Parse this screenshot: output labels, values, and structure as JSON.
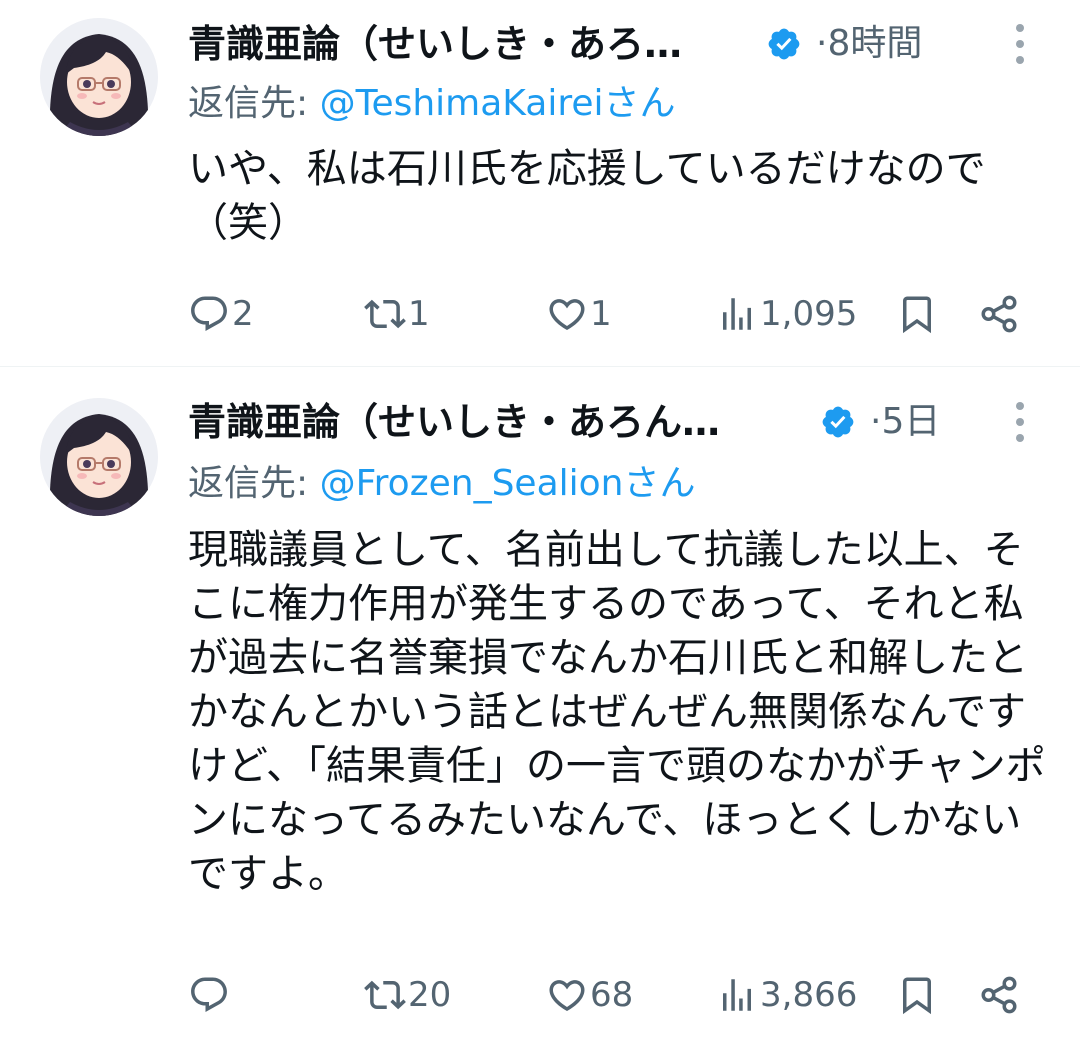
{
  "tweets": [
    {
      "display_name": "青識亜論（せいしき・あろ…",
      "time": "·8時間",
      "reply_prefix": "返信先: ",
      "reply_handle": "@TeshimaKaireiさん",
      "text": "いや、私は石川氏を応援しているだけなので（笑）",
      "replies": "2",
      "retweets": "1",
      "likes": "1",
      "views": "1,095"
    },
    {
      "display_name": "青識亜論（せいしき・あろん…",
      "time": "·5日",
      "reply_prefix": "返信先: ",
      "reply_handle": "@Frozen_Sealionさん",
      "text": "現職議員として、名前出して抗議した以上、そこに権力作用が発生するのであって、それと私が過去に名誉棄損でなんか石川氏と和解したとかなんとかいう話とはぜんぜん無関係なんですけど、「結果責任」の一言で頭のなかがチャンポンになってるみたいなんで、ほっとくしかないですよ。",
      "replies": "",
      "retweets": "20",
      "likes": "68",
      "views": "3,866"
    }
  ],
  "colors": {
    "text": "#0f1419",
    "secondary": "#536471",
    "link": "#1d9bf0",
    "verified": "#1d9bf0",
    "divider": "#eff3f4"
  },
  "icons": [
    "avatar-icon",
    "verified-badge-icon",
    "more-options-icon",
    "reply-icon",
    "retweet-icon",
    "like-icon",
    "views-icon",
    "bookmark-icon",
    "share-icon"
  ]
}
